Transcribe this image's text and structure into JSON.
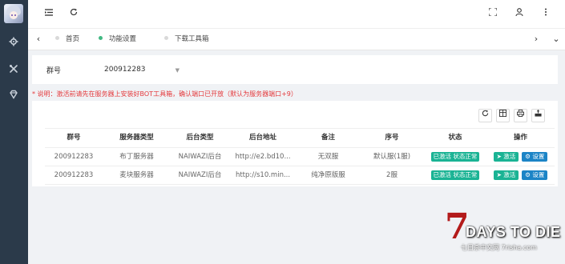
{
  "header": {
    "icons": [
      "menu-icon",
      "refresh-icon",
      "fullscreen-icon",
      "user-icon",
      "more-icon"
    ]
  },
  "sidebar": {
    "icons": [
      "gear-icon",
      "tools-icon",
      "gem-icon"
    ]
  },
  "tabs": [
    {
      "label": "首页",
      "active": false
    },
    {
      "label": "功能设置",
      "active": true
    },
    {
      "label": "下载工具箱",
      "active": false
    }
  ],
  "filter": {
    "group_label": "群号",
    "group_value": "200912283"
  },
  "notice": "* 说明：激活前请先在服务器上安装好BOT工具箱，确认端口已开放（默认为服务器端口+9）",
  "toolbar": {
    "icons": [
      "refresh-icon",
      "columns-icon",
      "print-icon",
      "export-icon"
    ]
  },
  "table": {
    "headers": [
      "群号",
      "服务器类型",
      "后台类型",
      "后台地址",
      "备注",
      "序号",
      "状态",
      "操作"
    ],
    "rows": [
      {
        "group": "200912283",
        "server_type": "布丁服务器",
        "backend_type": "NAIWAZI后台",
        "address": "http://e2.bd10...",
        "remark": "无双服",
        "order": "默认服(1服)",
        "status": "已激活 状态正常",
        "activate": "激活",
        "settings": "设置"
      },
      {
        "group": "200912283",
        "server_type": "麦块服务器",
        "backend_type": "NAIWAZI后台",
        "address": "http://s10.min...",
        "remark": "纯净原版服",
        "order": "2服",
        "status": "已激活 状态正常",
        "activate": "激活",
        "settings": "设置"
      }
    ]
  },
  "watermark": {
    "number": "7",
    "title": "DAYS TO DIE",
    "subtitle": "七日杀中文网 7risha.com"
  }
}
